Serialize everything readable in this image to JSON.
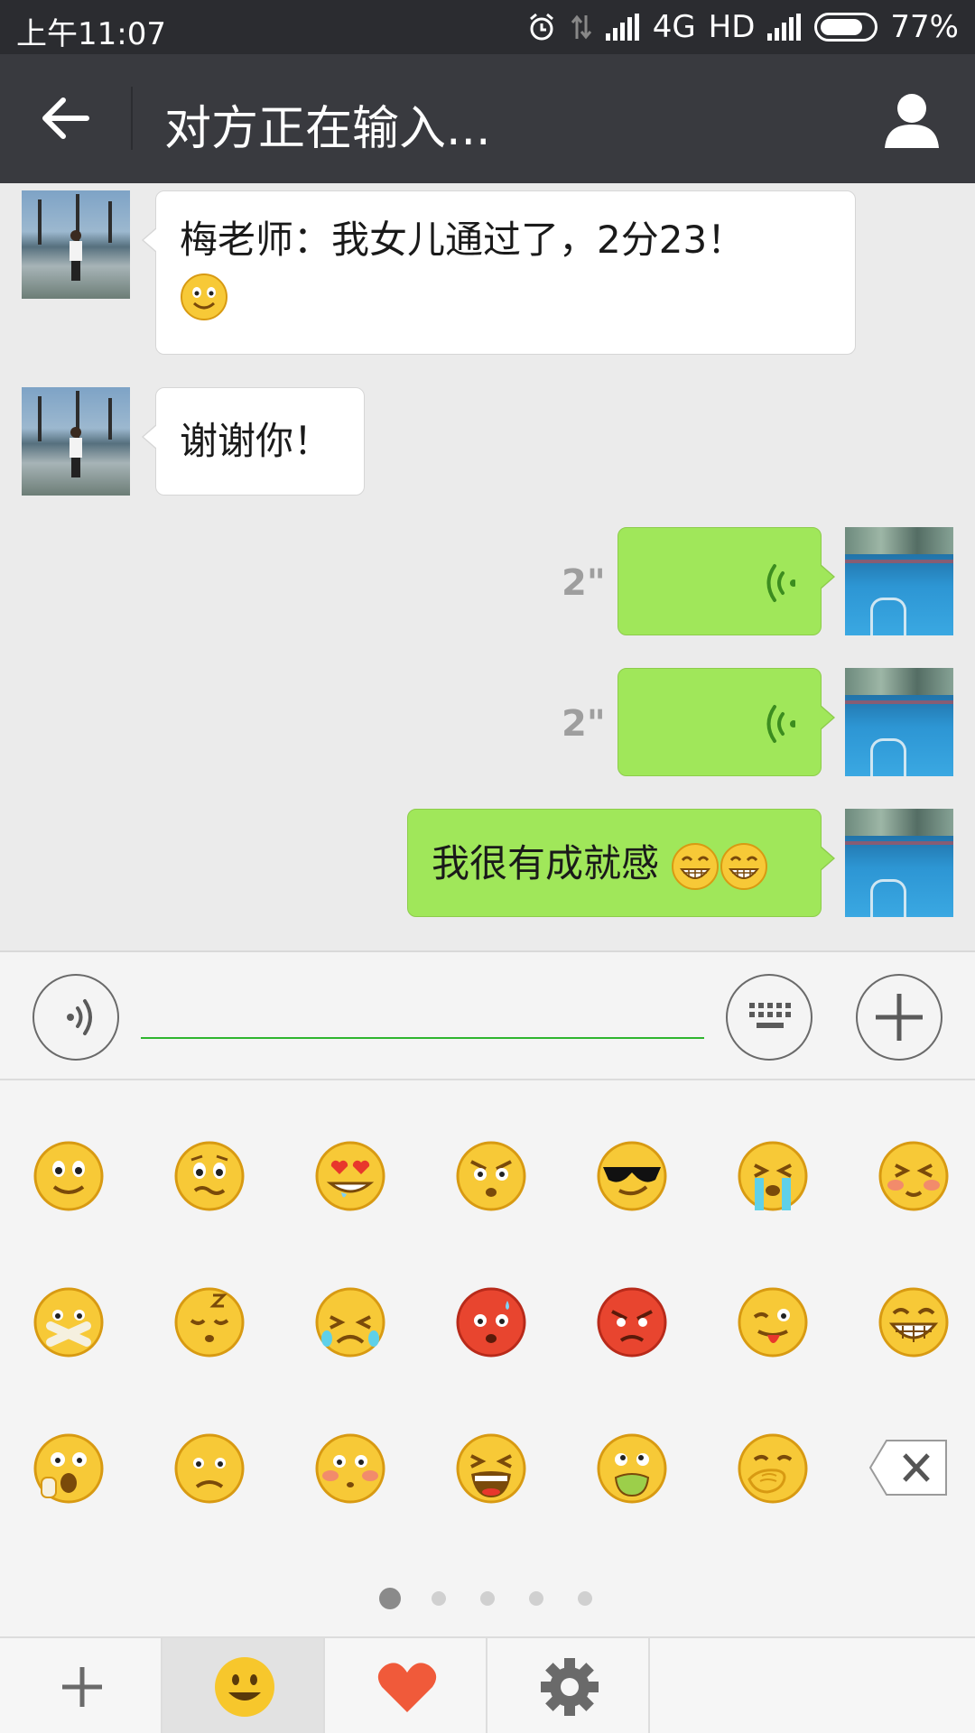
{
  "status_bar": {
    "time": "上午11:07",
    "network": "4G",
    "hd": "HD",
    "battery": "77%",
    "battery_level": 0.77
  },
  "header": {
    "title": "对方正在输入..."
  },
  "messages": [
    {
      "side": "in",
      "text": "梅老师：我女儿通过了，2分23！",
      "emoji": "smile-emoji"
    },
    {
      "side": "in",
      "text": "谢谢你！"
    },
    {
      "side": "out",
      "type": "voice",
      "duration": "2\""
    },
    {
      "side": "out",
      "type": "voice",
      "duration": "2\""
    },
    {
      "side": "out",
      "text": "我很有成就感",
      "emoji": "grin-emoji x2"
    }
  ],
  "input": {
    "value": "",
    "placeholder": ""
  },
  "emoji_panel": {
    "emojis": [
      "smile",
      "awkward",
      "drool",
      "shocked",
      "cool",
      "crying",
      "shy",
      "shut-up",
      "sleep",
      "cry",
      "embarrassed",
      "angry",
      "tongue",
      "grin",
      "surprised",
      "sad",
      "blush",
      "scream",
      "puke",
      "cover-mouth"
    ],
    "pages": 5,
    "current_page": 1
  },
  "tabs": [
    "add",
    "emoji",
    "favorite",
    "settings"
  ],
  "colors": {
    "title_bar": "#393a3f",
    "status_bar": "#2b2c30",
    "bubble_out": "#a0e75a",
    "bubble_in": "#ffffff",
    "accent_green": "#2fb52f"
  }
}
